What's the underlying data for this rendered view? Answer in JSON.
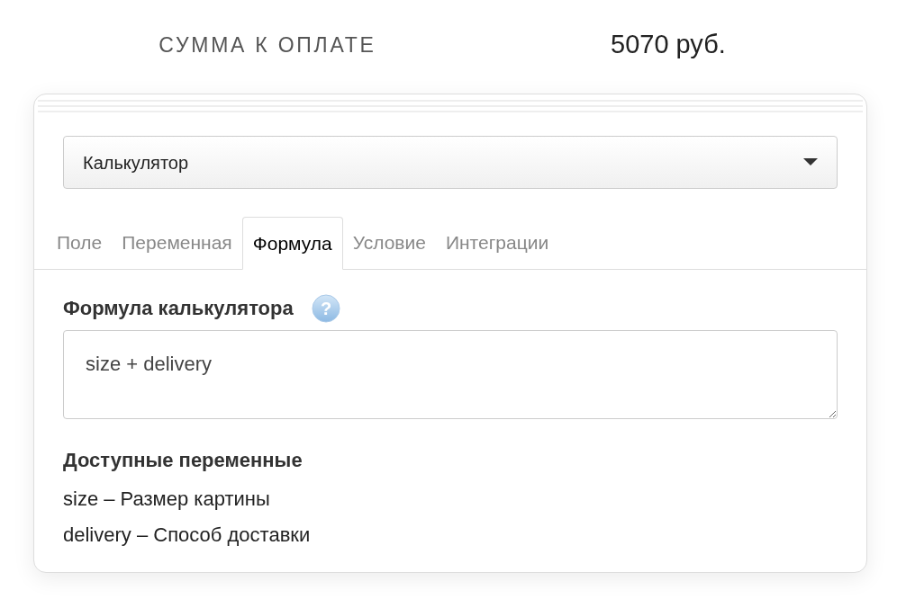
{
  "total": {
    "label": "СУММА К ОПЛАТЕ",
    "value": "5070 руб."
  },
  "select": {
    "value": "Калькулятор"
  },
  "tabs": [
    {
      "label": "Поле",
      "selected": false
    },
    {
      "label": "Переменная",
      "selected": false
    },
    {
      "label": "Формула",
      "selected": true
    },
    {
      "label": "Условие",
      "selected": false
    },
    {
      "label": "Интеграции",
      "selected": false
    }
  ],
  "formula": {
    "label": "Формула калькулятора",
    "help": "?",
    "value": "size + delivery"
  },
  "variables": {
    "heading": "Доступные переменные",
    "items": [
      "size – Размер картины",
      "delivery – Способ доставки"
    ]
  }
}
